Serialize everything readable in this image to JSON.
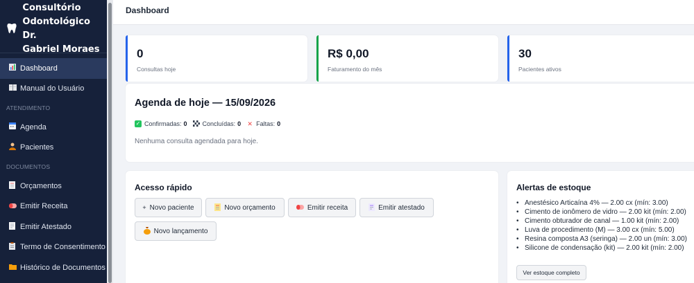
{
  "sidebar": {
    "brand_icon": "tooth-icon",
    "brand_line1": "Consultório",
    "brand_line2": "Odontológico Dr.",
    "brand_line3": "Gabriel Moraes",
    "items": [
      {
        "label": "Dashboard",
        "icon": "chart-icon",
        "glyph": "▮"
      },
      {
        "label": "Manual do Usuário",
        "icon": "book-icon",
        "glyph": "▭"
      },
      {
        "label": "Agenda",
        "icon": "calendar-icon",
        "glyph": "▦"
      },
      {
        "label": "Pacientes",
        "icon": "person-icon",
        "glyph": "☻"
      },
      {
        "label": "Orçamentos",
        "icon": "document-icon",
        "glyph": "▤"
      },
      {
        "label": "Emitir Receita",
        "icon": "pill-icon",
        "glyph": "◖"
      },
      {
        "label": "Emitir Atestado",
        "icon": "page-icon",
        "glyph": "▤"
      },
      {
        "label": "Termo de Consentimento",
        "icon": "clipboard-icon",
        "glyph": "▥"
      },
      {
        "label": "Histórico de Documentos",
        "icon": "folder-icon",
        "glyph": "▬"
      }
    ],
    "sections": {
      "atendimento": "ATENDIMENTO",
      "documentos": "DOCUMENTOS"
    }
  },
  "header": {
    "title": "Dashboard"
  },
  "stats": [
    {
      "value": "0",
      "label": "Consultas hoje",
      "color": "#2563eb"
    },
    {
      "value": "R$ 0,00",
      "label": "Faturamento do mês",
      "color": "#16a34a"
    },
    {
      "value": "30",
      "label": "Pacientes ativos",
      "color": "#2563eb"
    }
  ],
  "agenda": {
    "title": "Agenda de hoje — 15/09/2026",
    "confirmed_label": "Confirmadas:",
    "confirmed_count": "0",
    "completed_label": "Concluídas:",
    "completed_count": "0",
    "missed_label": "Faltas:",
    "missed_count": "0",
    "empty_text": "Nenhuma consulta agendada para hoje."
  },
  "quick_access": {
    "title": "Acesso rápido",
    "buttons": [
      {
        "label": "Novo paciente",
        "icon": "plus-icon",
        "glyph": "+"
      },
      {
        "label": "Novo orçamento",
        "icon": "document-icon",
        "glyph": "▤"
      },
      {
        "label": "Emitir receita",
        "icon": "pill-icon",
        "glyph": "◖"
      },
      {
        "label": "Emitir atestado",
        "icon": "page-icon",
        "glyph": "▤"
      },
      {
        "label": "Novo lançamento",
        "icon": "money-bag-icon",
        "glyph": "●"
      }
    ]
  },
  "stock_alerts": {
    "title": "Alertas de estoque",
    "items": [
      "Anestésico Articaína 4% — 2.00 cx (mín: 3.00)",
      "Cimento de ionômero de vidro — 2.00 kit (mín: 2.00)",
      "Cimento obturador de canal — 1.00 kit (mín: 2.00)",
      "Luva de procedimento (M) — 3.00 cx (mín: 5.00)",
      "Resina composta A3 (seringa) — 2.00 un (mín: 3.00)",
      "Silicone de condensação (kit) — 2.00 kit (mín: 2.00)"
    ],
    "button_label": "Ver estoque completo"
  }
}
